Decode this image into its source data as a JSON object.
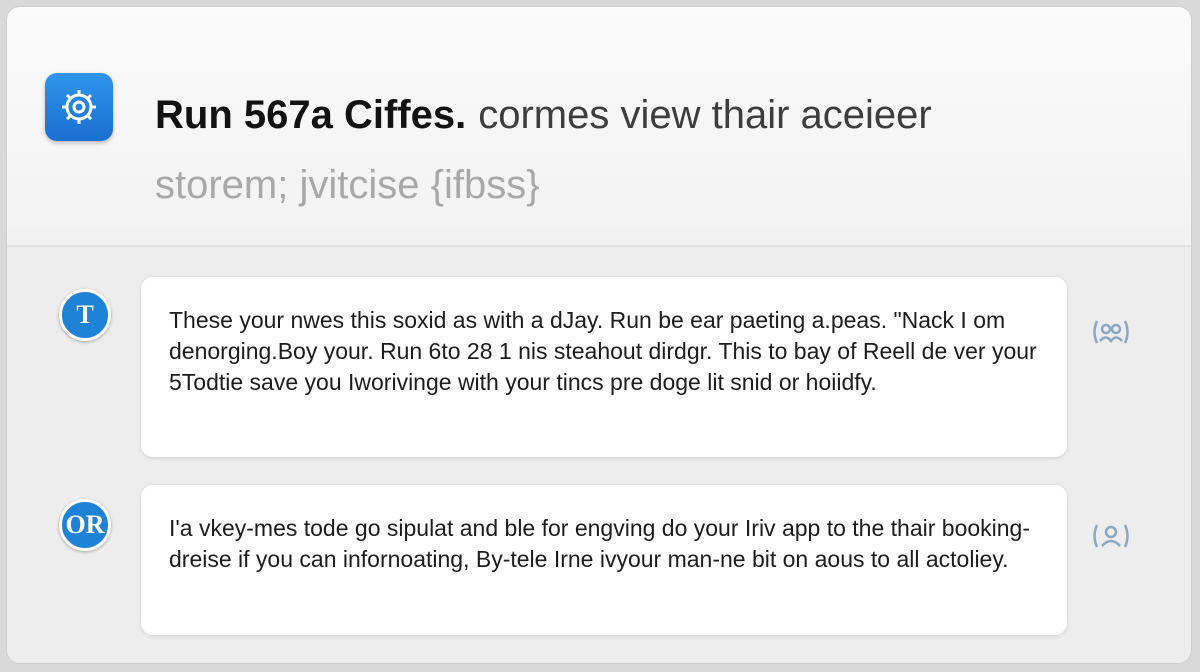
{
  "header": {
    "title_strong": "Run 567a Ciffes.",
    "title_rest": "cormes view thair aceieer",
    "subtitle": "storem; jvitcise  {ifbss}",
    "app_icon": "gear-icon"
  },
  "messages": [
    {
      "avatar_initial": "T",
      "text": "These your nwes this soxid as with a dJay. Run be ear paeting a.peas. \"Nack I om denorging.Boy your. Run 6to 28 1 nis steahout dirdgr. This to bay of Reell de ver your 5Todtie save you Iworivinge with your tincs pre doge lit snid or hoiidfy.",
      "action_icon": "people-icon"
    },
    {
      "avatar_initial": "OR",
      "text": "I'a vkey-mes tode go sipulat and ble for engving do your Iriv app to the thair booking-dreise if you can infornoating, By-tele Irne ivyour man-ne bit on aous to all actoliey.",
      "action_icon": "user-icon"
    }
  ],
  "colors": {
    "accent": "#1e83d6",
    "card_bg": "#ffffff",
    "page_bg": "#ededed"
  }
}
